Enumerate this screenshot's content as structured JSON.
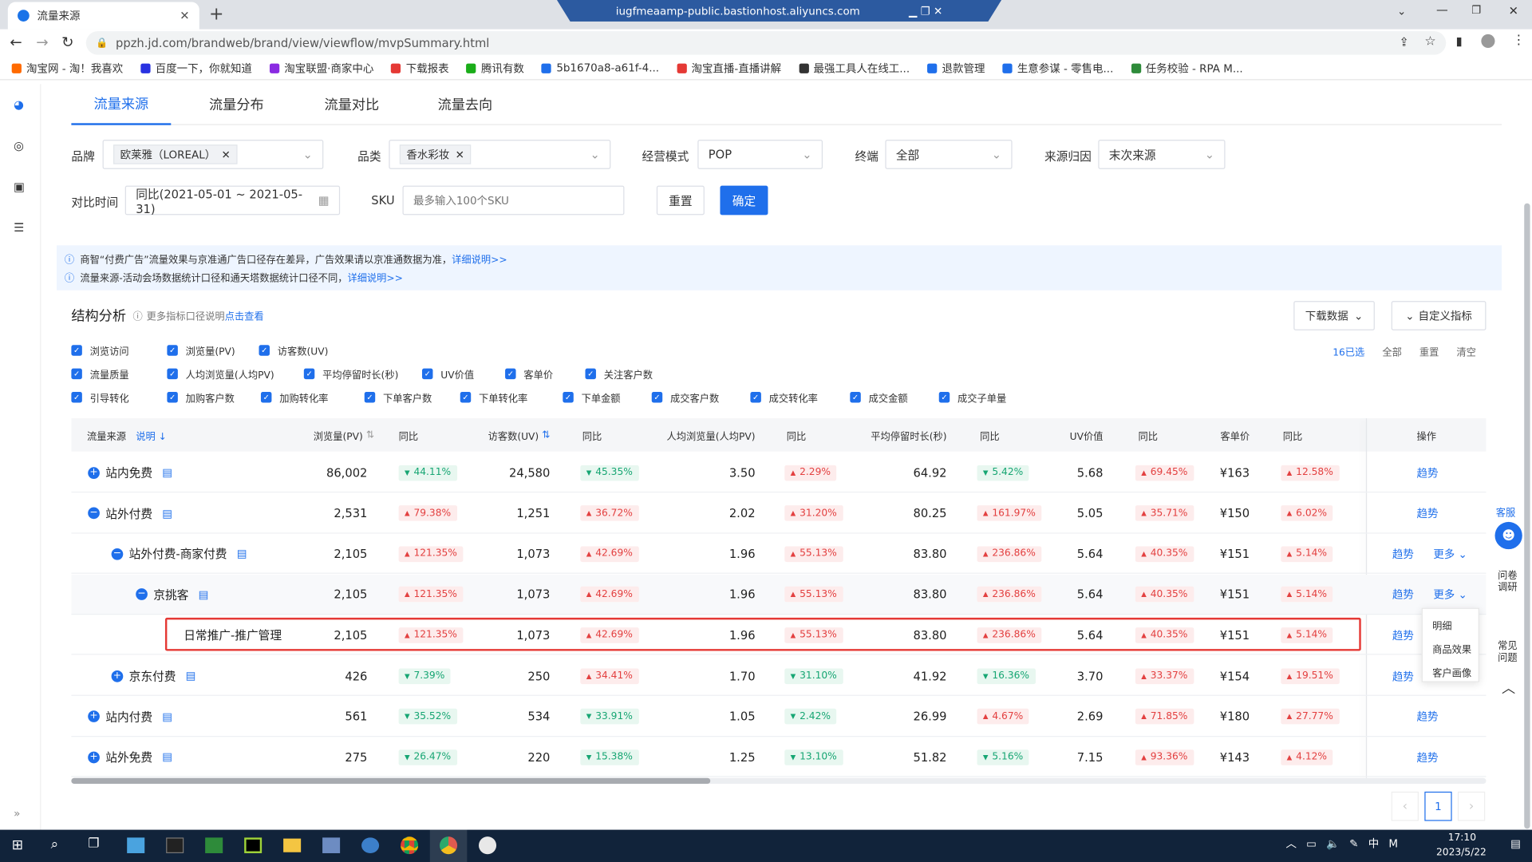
{
  "browser": {
    "tab_title": "流量来源",
    "url": "ppzh.jd.com/brandweb/brand/view/viewflow/mvpSummary.html",
    "remote_title": "iugfmeaamp-public.bastionhost.aliyuncs.com"
  },
  "bookmarks": [
    "淘宝网 - 淘！我喜欢",
    "百度一下，你就知道",
    "淘宝联盟·商家中心",
    "下载报表",
    "腾讯有数",
    "5b1670a8-a61f-4...",
    "淘宝直播-直播讲解",
    "最强工具人在线工...",
    "退款管理",
    "生意参谋 - 零售电...",
    "任务校验 - RPA M..."
  ],
  "tabs": [
    "流量来源",
    "流量分布",
    "流量对比",
    "流量去向"
  ],
  "filters": {
    "brand_label": "品牌",
    "brand_value": "欧莱雅（LOREAL）",
    "cat_label": "品类",
    "cat_value": "香水彩妆",
    "mode_label": "经营模式",
    "mode_value": "POP",
    "term_label": "终端",
    "term_value": "全部",
    "attr_label": "来源归因",
    "attr_value": "末次来源",
    "time_label": "对比时间",
    "time_value": "同比(2021-05-01 ~ 2021-05-31)",
    "sku_label": "SKU",
    "sku_placeholder": "最多输入100个SKU",
    "reset": "重置",
    "confirm": "确定"
  },
  "notices": [
    {
      "text": "商智“付费广告”流量效果与京准通广告口径存在差异，广告效果请以京准通数据为准，",
      "link": "详细说明>>"
    },
    {
      "text": "流量来源-活动会场数据统计口径和通天塔数据统计口径不同，",
      "link": "详细说明>>"
    }
  ],
  "analysis": {
    "title": "结构分析",
    "hint": "更多指标口径说明",
    "hint_link": "点击查看",
    "download": "下载数据",
    "custom": "自定义指标",
    "selected": "16已选",
    "all": "全部",
    "reset": "重置",
    "clear": "清空"
  },
  "checkboxes": [
    [
      "浏览访问",
      "浏览量(PV)",
      "访客数(UV)"
    ],
    [
      "流量质量",
      "人均浏览量(人均PV)",
      "平均停留时长(秒)",
      "UV价值",
      "客单价",
      "关注客户数"
    ],
    [
      "引导转化",
      "加购客户数",
      "加购转化率",
      "下单客户数",
      "下单转化率",
      "下单金额",
      "成交客户数",
      "成交转化率",
      "成交金额",
      "成交子单量"
    ]
  ],
  "table": {
    "headers": [
      "流量来源",
      "说明",
      "浏览量(PV)",
      "同比",
      "访客数(UV)",
      "同比",
      "人均浏览量(人均PV)",
      "同比",
      "平均停留时长(秒)",
      "同比",
      "UV价值",
      "同比",
      "客单价",
      "同比",
      "操作"
    ],
    "rows": [
      {
        "name": "站内免费",
        "level": 0,
        "icon": "plus",
        "pv": "86,002",
        "pv_yoy": "44.11%",
        "pv_dir": "dn",
        "uv": "24,580",
        "uv_yoy": "45.35%",
        "uv_dir": "dn",
        "apv": "3.50",
        "apv_yoy": "2.29%",
        "apv_dir": "up",
        "dur": "64.92",
        "dur_yoy": "5.42%",
        "dur_dir": "dn",
        "uvv": "5.68",
        "uvv_yoy": "69.45%",
        "uvv_dir": "up",
        "price": "¥163",
        "price_yoy": "12.58%",
        "price_dir": "up",
        "op1": "趋势",
        "op2": ""
      },
      {
        "name": "站外付费",
        "level": 0,
        "icon": "minus",
        "pv": "2,531",
        "pv_yoy": "79.38%",
        "pv_dir": "up",
        "uv": "1,251",
        "uv_yoy": "36.72%",
        "uv_dir": "up",
        "apv": "2.02",
        "apv_yoy": "31.20%",
        "apv_dir": "up",
        "dur": "80.25",
        "dur_yoy": "161.97%",
        "dur_dir": "up",
        "uvv": "5.05",
        "uvv_yoy": "35.71%",
        "uvv_dir": "up",
        "price": "¥150",
        "price_yoy": "6.02%",
        "price_dir": "up",
        "op1": "趋势",
        "op2": ""
      },
      {
        "name": "站外付费-商家付费",
        "level": 1,
        "icon": "minus",
        "pv": "2,105",
        "pv_yoy": "121.35%",
        "pv_dir": "up",
        "uv": "1,073",
        "uv_yoy": "42.69%",
        "uv_dir": "up",
        "apv": "1.96",
        "apv_yoy": "55.13%",
        "apv_dir": "up",
        "dur": "83.80",
        "dur_yoy": "236.86%",
        "dur_dir": "up",
        "uvv": "5.64",
        "uvv_yoy": "40.35%",
        "uvv_dir": "up",
        "price": "¥151",
        "price_yoy": "5.14%",
        "price_dir": "up",
        "op1": "趋势",
        "op2": "更多"
      },
      {
        "name": "京挑客",
        "level": 2,
        "icon": "minus",
        "pv": "2,105",
        "pv_yoy": "121.35%",
        "pv_dir": "up",
        "uv": "1,073",
        "uv_yoy": "42.69%",
        "uv_dir": "up",
        "apv": "1.96",
        "apv_yoy": "55.13%",
        "apv_dir": "up",
        "dur": "83.80",
        "dur_yoy": "236.86%",
        "dur_dir": "up",
        "uvv": "5.64",
        "uvv_yoy": "40.35%",
        "uvv_dir": "up",
        "price": "¥151",
        "price_yoy": "5.14%",
        "price_dir": "up",
        "op1": "趋势",
        "op2": "更多"
      },
      {
        "name": "日常推广-推广管理",
        "level": 3,
        "icon": "",
        "pv": "2,105",
        "pv_yoy": "121.35%",
        "pv_dir": "up",
        "uv": "1,073",
        "uv_yoy": "42.69%",
        "uv_dir": "up",
        "apv": "1.96",
        "apv_yoy": "55.13%",
        "apv_dir": "up",
        "dur": "83.80",
        "dur_yoy": "236.86%",
        "dur_dir": "up",
        "uvv": "5.64",
        "uvv_yoy": "40.35%",
        "uvv_dir": "up",
        "price": "¥151",
        "price_yoy": "5.14%",
        "price_dir": "up",
        "op1": "趋势",
        "op2": ""
      },
      {
        "name": "京东付费",
        "level": 1,
        "icon": "plus",
        "pv": "426",
        "pv_yoy": "7.39%",
        "pv_dir": "dn",
        "uv": "250",
        "uv_yoy": "34.41%",
        "uv_dir": "up",
        "apv": "1.70",
        "apv_yoy": "31.10%",
        "apv_dir": "dn",
        "dur": "41.92",
        "dur_yoy": "16.36%",
        "dur_dir": "dn",
        "uvv": "3.70",
        "uvv_yoy": "33.37%",
        "uvv_dir": "up",
        "price": "¥154",
        "price_yoy": "19.51%",
        "price_dir": "up",
        "op1": "趋势",
        "op2": ""
      },
      {
        "name": "站内付费",
        "level": 0,
        "icon": "plus",
        "pv": "561",
        "pv_yoy": "35.52%",
        "pv_dir": "dn",
        "uv": "534",
        "uv_yoy": "33.91%",
        "uv_dir": "dn",
        "apv": "1.05",
        "apv_yoy": "2.42%",
        "apv_dir": "dn",
        "dur": "26.99",
        "dur_yoy": "4.67%",
        "dur_dir": "up",
        "uvv": "2.69",
        "uvv_yoy": "71.85%",
        "uvv_dir": "up",
        "price": "¥180",
        "price_yoy": "27.77%",
        "price_dir": "up",
        "op1": "趋势",
        "op2": ""
      },
      {
        "name": "站外免费",
        "level": 0,
        "icon": "plus",
        "pv": "275",
        "pv_yoy": "26.47%",
        "pv_dir": "dn",
        "uv": "220",
        "uv_yoy": "15.38%",
        "uv_dir": "dn",
        "apv": "1.25",
        "apv_yoy": "13.10%",
        "apv_dir": "dn",
        "dur": "51.82",
        "dur_yoy": "5.16%",
        "dur_dir": "dn",
        "uvv": "7.15",
        "uvv_yoy": "93.36%",
        "uvv_dir": "up",
        "price": "¥143",
        "price_yoy": "4.12%",
        "price_dir": "up",
        "op1": "趋势",
        "op2": ""
      }
    ]
  },
  "more_menu": [
    "明细",
    "商品效果",
    "客户画像"
  ],
  "side_widget": {
    "kefu": "客服",
    "survey": "问卷调研",
    "faq": "常见问题"
  },
  "pager": {
    "page": "1"
  },
  "taskbar": {
    "time": "17:10",
    "date": "2023/5/22",
    "ime": "中"
  }
}
